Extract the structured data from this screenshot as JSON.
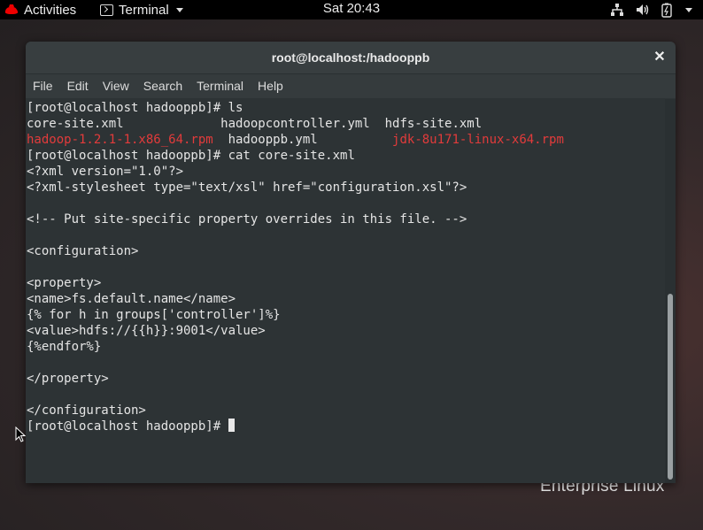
{
  "topbar": {
    "activities": "Activities",
    "app_name": "Terminal",
    "clock": "Sat 20:43",
    "tray_icons": [
      "network-icon",
      "volume-icon",
      "battery-icon",
      "system-menu-icon"
    ]
  },
  "wallpaper": {
    "text": "Enterprise Linux"
  },
  "window": {
    "title": "root@localhost:/hadooppb",
    "menu": [
      "File",
      "Edit",
      "View",
      "Search",
      "Terminal",
      "Help"
    ]
  },
  "terminal": {
    "prompt": "[root@localhost hadooppb]# ",
    "cmd_ls": "ls",
    "files": {
      "f1": "core-site.xml",
      "f2": "hadoopcontroller.yml",
      "f3": "hdfs-site.xml",
      "f4": "hadoop-1.2.1-1.x86_64.rpm",
      "f5": "hadooppb.yml",
      "f6": "jdk-8u171-linux-x64.rpm"
    },
    "cmd_cat": "cat core-site.xml",
    "lines": [
      "<?xml version=\"1.0\"?>",
      "<?xml-stylesheet type=\"text/xsl\" href=\"configuration.xsl\"?>",
      "",
      "<!-- Put site-specific property overrides in this file. -->",
      "",
      "<configuration>",
      "",
      "<property>",
      "<name>fs.default.name</name>",
      "{% for h in groups['controller']%}",
      "<value>hdfs://{{h}}:9001</value>",
      "{%endfor%}",
      "",
      "</property>",
      "",
      "</configuration>"
    ]
  },
  "colors": {
    "file_highlight": "#e23b3b",
    "terminal_bg": "#2d3335"
  }
}
